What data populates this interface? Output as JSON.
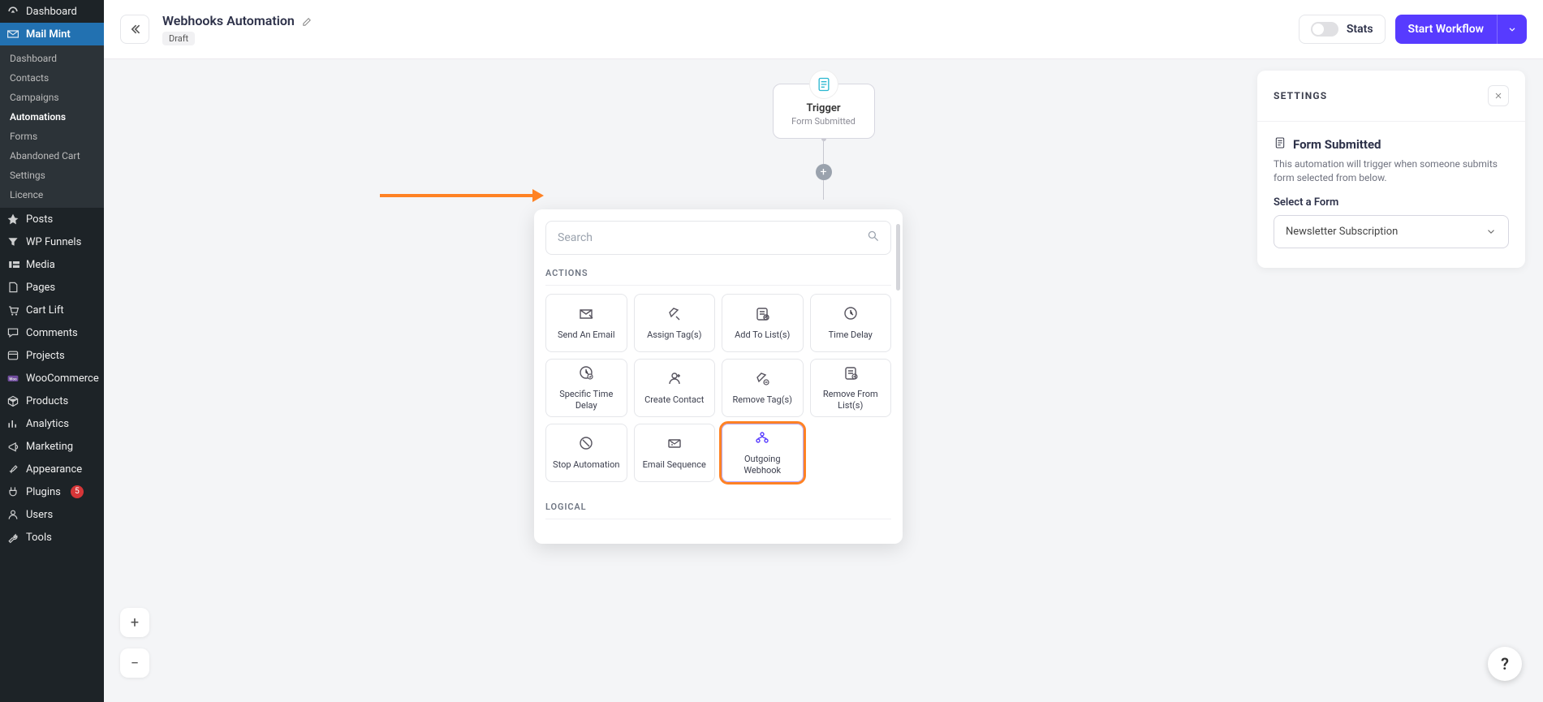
{
  "sidebar": {
    "top": [
      {
        "label": "Dashboard",
        "icon": "gauge"
      }
    ],
    "active_top": {
      "label": "Mail Mint",
      "icon": "mailmint"
    },
    "submenu": [
      {
        "label": "Dashboard"
      },
      {
        "label": "Contacts"
      },
      {
        "label": "Campaigns"
      },
      {
        "label": "Automations",
        "active": true
      },
      {
        "label": "Forms"
      },
      {
        "label": "Abandoned Cart"
      },
      {
        "label": "Settings"
      },
      {
        "label": "Licence"
      }
    ],
    "rest": [
      {
        "label": "Posts",
        "icon": "pin"
      },
      {
        "label": "WP Funnels",
        "icon": "funnel"
      },
      {
        "label": "Media",
        "icon": "media"
      },
      {
        "label": "Pages",
        "icon": "page"
      },
      {
        "label": "Cart Lift",
        "icon": "cart"
      },
      {
        "label": "Comments",
        "icon": "comment"
      },
      {
        "label": "Projects",
        "icon": "projects"
      },
      {
        "label": "WooCommerce",
        "icon": "woo"
      },
      {
        "label": "Products",
        "icon": "box"
      },
      {
        "label": "Analytics",
        "icon": "analytics"
      },
      {
        "label": "Marketing",
        "icon": "marketing"
      },
      {
        "label": "Appearance",
        "icon": "brush"
      },
      {
        "label": "Plugins",
        "icon": "plug",
        "badge": "5"
      },
      {
        "label": "Users",
        "icon": "users"
      },
      {
        "label": "Tools",
        "icon": "tools"
      }
    ]
  },
  "header": {
    "title": "Webhooks Automation",
    "status_chip": "Draft",
    "stats_label": "Stats",
    "start_label": "Start Workflow"
  },
  "trigger": {
    "title": "Trigger",
    "subtitle": "Form Submitted"
  },
  "popover": {
    "search_placeholder": "Search",
    "section_actions": "ACTIONS",
    "section_logical": "LOGICAL",
    "actions": [
      "Send An Email",
      "Assign Tag(s)",
      "Add To List(s)",
      "Time Delay",
      "Specific Time Delay",
      "Create Contact",
      "Remove Tag(s)",
      "Remove From List(s)",
      "Stop Automation",
      "Email Sequence",
      "Outgoing Webhook"
    ],
    "highlight_index": 10
  },
  "settings": {
    "heading": "SETTINGS",
    "form_title": "Form Submitted",
    "form_help": "This automation will trigger when someone submits form selected from below.",
    "select_label": "Select a Form",
    "select_value": "Newsletter Subscription"
  }
}
